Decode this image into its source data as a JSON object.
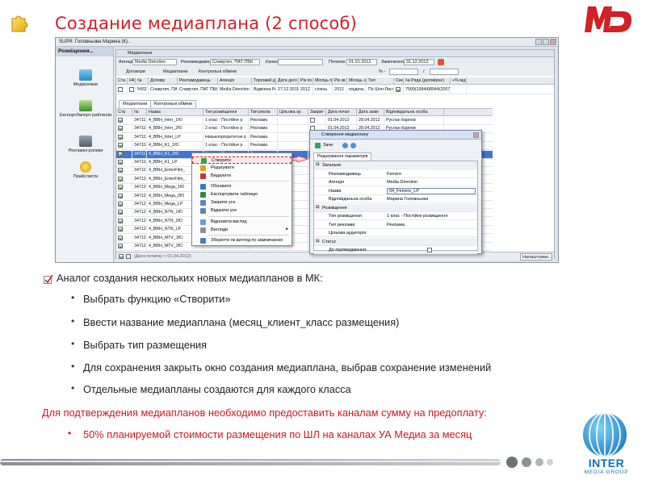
{
  "slide": {
    "title": "Создание медиаплана (2 способ)"
  },
  "window": {
    "title": "SUPR: Головньова Марина (К)..",
    "left_panel": {
      "header": "Розміщення...",
      "items": [
        {
          "label": "Медіаплани",
          "icon": "grid-icon"
        },
        {
          "label": "Експорт/Імпорт рейтингів",
          "icon": "table-icon"
        },
        {
          "label": "Рекламні ролики",
          "icon": "film-icon"
        },
        {
          "label": "Прайслисти",
          "icon": "coin-icon"
        }
      ]
    },
    "mdi_title": "Медіаплани",
    "filters": {
      "agency_label": "Агенція",
      "agency_value": "Media Direction",
      "advertiser_label": "Рекламодавець",
      "advertiser_value": "Славутич, ПАТ ПБК",
      "channel_label": "Канал",
      "start_label": "Початок",
      "start_value": "01.01.2012",
      "end_label": "Закінчення",
      "end_value": "31.12.2012",
      "pct_label": "% -",
      "slash": "/"
    },
    "toolbar": {
      "contracts": "Договори",
      "mediaplans": "Медіаплани",
      "control": "Контрольні обміни"
    },
    "contracts_grid": {
      "headers": [
        "Ста",
        "НК",
        "№",
        "Договір",
        "Рекламодавець",
        "Агенція",
        "Торговий д",
        "Дата дого",
        "Рік по",
        "Місяць по",
        "Рік зв",
        "Місяць зв",
        "Тип",
        "Синх",
        "№ Ряда (договірне)",
        "+% від"
      ],
      "row": [
        "",
        "",
        "5432",
        "Славутич, ПАТ ПБ",
        "Славутич, ПАТ ПБК",
        "Media Direction",
        "Відмінна Рекл",
        "27.12.2011",
        "2012",
        "січень",
        "2012",
        "грудень",
        "По Шоп-Листу",
        "",
        "7509(19844)8044(2007",
        ""
      ]
    },
    "tabs": [
      "Медіаплани",
      "Контрольні обміни"
    ],
    "mp_grid": {
      "headers": [
        "Ста",
        "№",
        "Назва",
        "Тип розміщення",
        "Тип рекла",
        "Цільова ау",
        "Закрит",
        "Дата почат",
        "Дата закін",
        "Відповідальна особа"
      ],
      "rows": [
        [
          "347113",
          "4_BBH_Inter_1Ю",
          "1 клас - Постійне р",
          "Реклама",
          "",
          "01.04.2012",
          "28.04.2012",
          "Руслан Карпов"
        ],
        [
          "347114",
          "4_BBH_Inter_2Ю",
          "2 клас - Постійне р",
          "Реклама",
          "",
          "01.04.2012",
          "28.04.2012",
          "Руслан Карпов"
        ],
        [
          "347115",
          "4_BBH_Inter_LP",
          "Низькопріоритетне р",
          "Реклама",
          "",
          "",
          "",
          ""
        ],
        [
          "347116",
          "4_BBH_K1_1Ю",
          "1 клас - Постійне р",
          "Реклама",
          "",
          "",
          "",
          ""
        ],
        [
          "347117",
          "4_BBH_K1_2Ю",
          "2 клас - Постійне р",
          "Реклама",
          "",
          "",
          "",
          ""
        ],
        [
          "347118",
          "4_BBH_K1_LP",
          "",
          "",
          "",
          "",
          "",
          ""
        ],
        [
          "347119",
          "4_BBH_EnterFilm_",
          "",
          "",
          "",
          "",
          "",
          ""
        ],
        [
          "347120",
          "4_BBH_EnterFilm_",
          "",
          "",
          "",
          "",
          "",
          ""
        ],
        [
          "347121",
          "4_BBH_Mega_1Ю",
          "",
          "",
          "",
          "",
          "",
          ""
        ],
        [
          "347122",
          "4_BBH_Mega_2Ю",
          "",
          "",
          "",
          "",
          "",
          ""
        ],
        [
          "347123",
          "4_BBH_Mega_LP",
          "",
          "",
          "",
          "",
          "",
          ""
        ],
        [
          "347124",
          "4_BBH_NTN_1Ю",
          "",
          "",
          "",
          "",
          "",
          ""
        ],
        [
          "347125",
          "4_BBH_NTN_2Ю",
          "",
          "",
          "",
          "",
          "",
          ""
        ],
        [
          "347126",
          "4_BBH_NTN_LP",
          "",
          "",
          "",
          "",
          "",
          ""
        ],
        [
          "347127",
          "4_BBH_MTV_1Ю",
          "",
          "",
          "",
          "",
          "",
          ""
        ],
        [
          "347128",
          "4_BBH_MTV_2Ю",
          "",
          "",
          "",
          "",
          "",
          ""
        ]
      ],
      "selected_row": 4
    },
    "footer": {
      "filter_text": "(Дата початку < 01.04.2012)",
      "settings_button": "Налаштуван..."
    },
    "context_menu": [
      {
        "label": "Створити",
        "icon": "new-icon",
        "highlight": true
      },
      {
        "label": "Редагувати",
        "icon": "edit-icon"
      },
      {
        "label": "Видалити",
        "icon": "delete-icon"
      },
      {
        "label": "Обновити",
        "icon": "refresh-icon"
      },
      {
        "label": "Експортувати таблицю",
        "icon": "excel-icon"
      },
      {
        "label": "Закрити усе",
        "icon": "close-all-icon"
      },
      {
        "label": "Відкрити усе",
        "icon": "open-all-icon"
      },
      {
        "label": "Відновити вигляд",
        "icon": "restore-icon"
      },
      {
        "label": "Вигляди",
        "icon": "views-icon",
        "submenu": true
      },
      {
        "label": "Зберегти як вигляд по замовчанню",
        "icon": "save-icon"
      }
    ],
    "dialog": {
      "title": "Створення медіаплану",
      "close_label": "Зачи",
      "tab": "Редагування параметрів",
      "categories": [
        {
          "name": "Загальне",
          "props": [
            {
              "k": "Рекламодавець",
              "v": "Ferrero"
            },
            {
              "k": "Агенція",
              "v": "Media Direction"
            },
            {
              "k": "Назва",
              "v": "04_Ferrero_LP"
            },
            {
              "k": "Відповідальна особа",
              "v": "Марина Головньова"
            }
          ]
        },
        {
          "name": "Розміщення",
          "props": [
            {
              "k": "Тип розміщення",
              "v": "1 клас - Постійне розміщення"
            },
            {
              "k": "Тип реклами",
              "v": "Реклама"
            },
            {
              "k": "Цільова аудиторія",
              "v": ""
            }
          ]
        },
        {
          "name": "Статус",
          "props": [
            {
              "k": "До підтвердження",
              "v": ""
            }
          ]
        }
      ]
    }
  },
  "bullets": {
    "lead": "Аналог создания нескольких новых медиапланов в МК:",
    "items": [
      "Выбрать функцию «Створити»",
      "Ввести название медиаплана (месяц_клиент_класс размещения)",
      "Выбрать тип размещения",
      "Для сохранения закрыть окно создания медиаплана, выбрав сохранение изменений",
      "Отдельные медиапланы создаются для каждого класса"
    ],
    "red_note": "Для подтверждения медиапланов необходимо предоставить каналам сумму на предоплату:",
    "red_item": "50% планируемой стоимости размещения по ШЛ на каналах УА Медиа за месяц"
  },
  "brand": {
    "logo_letters": "MD",
    "inter_name": "INTER",
    "inter_sub": "MEDIA GROUP",
    "accent": "#d31f26",
    "inter_blue": "#2a9fd6"
  }
}
